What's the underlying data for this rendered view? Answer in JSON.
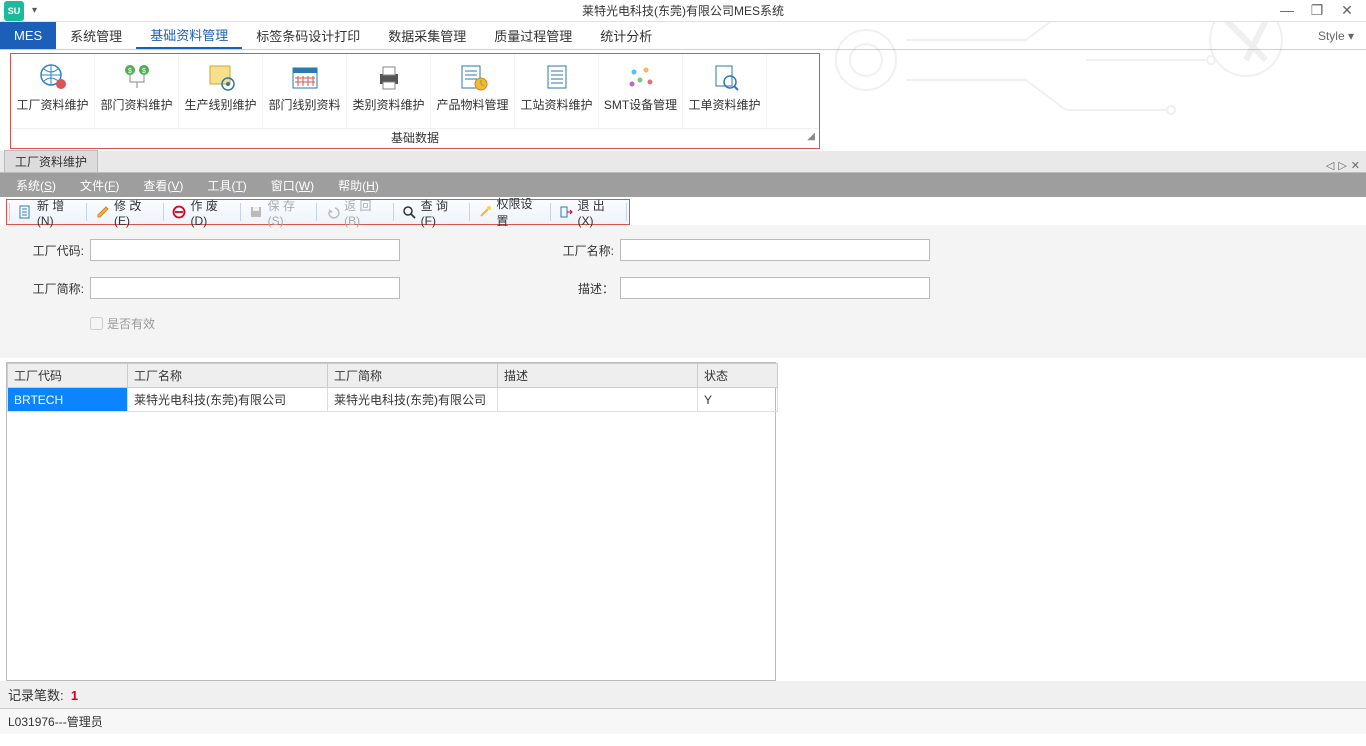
{
  "titlebar": {
    "title": "莱特光电科技(东莞)有限公司MES系统",
    "style_label": "Style"
  },
  "ribbon_tabs": {
    "mes": "MES",
    "items": [
      "系统管理",
      "基础资料管理",
      "标签条码设计打印",
      "数据采集管理",
      "质量过程管理",
      "统计分析"
    ]
  },
  "ribbon": {
    "caption": "基础数据",
    "items": [
      "工厂资料维护",
      "部门资料维护",
      "生产线别维护",
      "部门线别资料",
      "类别资料维护",
      "产品物料管理",
      "工站资料维护",
      "SMT设备管理",
      "工单资料维护"
    ]
  },
  "doc_tab": "工厂资料维护",
  "menu": {
    "items": [
      {
        "label": "系统",
        "key": "S"
      },
      {
        "label": "文件",
        "key": "F"
      },
      {
        "label": "查看",
        "key": "V"
      },
      {
        "label": "工具",
        "key": "T"
      },
      {
        "label": "窗口",
        "key": "W"
      },
      {
        "label": "帮助",
        "key": "H"
      }
    ]
  },
  "toolbar": {
    "new": "新 增(N)",
    "edit": "修 改(E)",
    "void": "作 废(D)",
    "save": "保 存(S)",
    "back": "返 回(B)",
    "query": "查 询(F)",
    "perm": "权限设置",
    "exit": "退 出(X)"
  },
  "form": {
    "code_label": "工厂代码:",
    "name_label": "工厂名称:",
    "short_label": "工厂简称:",
    "desc_label": "描述：",
    "valid_label": "是否有效"
  },
  "grid": {
    "cols": [
      "工厂代码",
      "工厂名称",
      "工厂简称",
      "描述",
      "状态"
    ],
    "rows": [
      {
        "code": "BRTECH",
        "name": "莱特光电科技(东莞)有限公司",
        "short": "莱特光电科技(东莞)有限公司",
        "desc": "",
        "status": "Y"
      }
    ]
  },
  "status": {
    "count_label": "记录笔数:",
    "count": "1",
    "user": "L031976---管理员"
  }
}
